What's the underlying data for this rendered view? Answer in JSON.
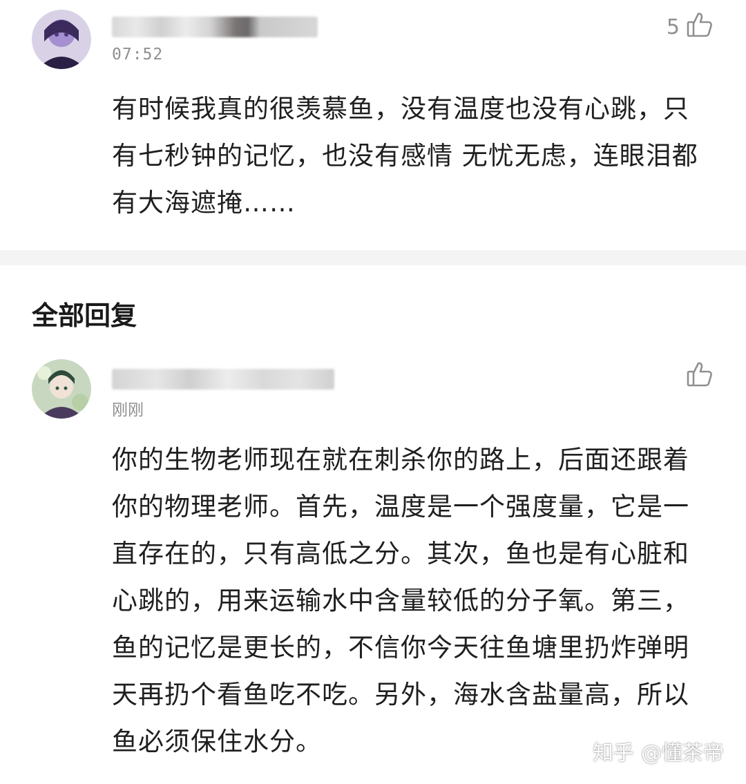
{
  "comment": {
    "time": "07:52",
    "like_count": "5",
    "text": "有时候我真的很羡慕鱼，没有温度也没有心跳，只有七秒钟的记忆，也没有感情 无忧无虑，连眼泪都有大海遮掩……"
  },
  "replies_section": {
    "title": "全部回复"
  },
  "reply": {
    "time": "刚刚",
    "text": "你的生物老师现在就在刺杀你的路上，后面还跟着你的物理老师。首先，温度是一个强度量，它是一直存在的，只有高低之分。其次，鱼也是有心脏和心跳的，用来运输水中含量较低的分子氧。第三，鱼的记忆是更长的，不信你今天往鱼塘里扔炸弹明天再扔个看鱼吃不吃。另外，海水含盐量高，所以鱼必须保住水分。"
  },
  "watermark": {
    "brand": "知乎",
    "handle": "@懂茶帝"
  },
  "icons": {
    "like": "thumbs-up-icon"
  }
}
